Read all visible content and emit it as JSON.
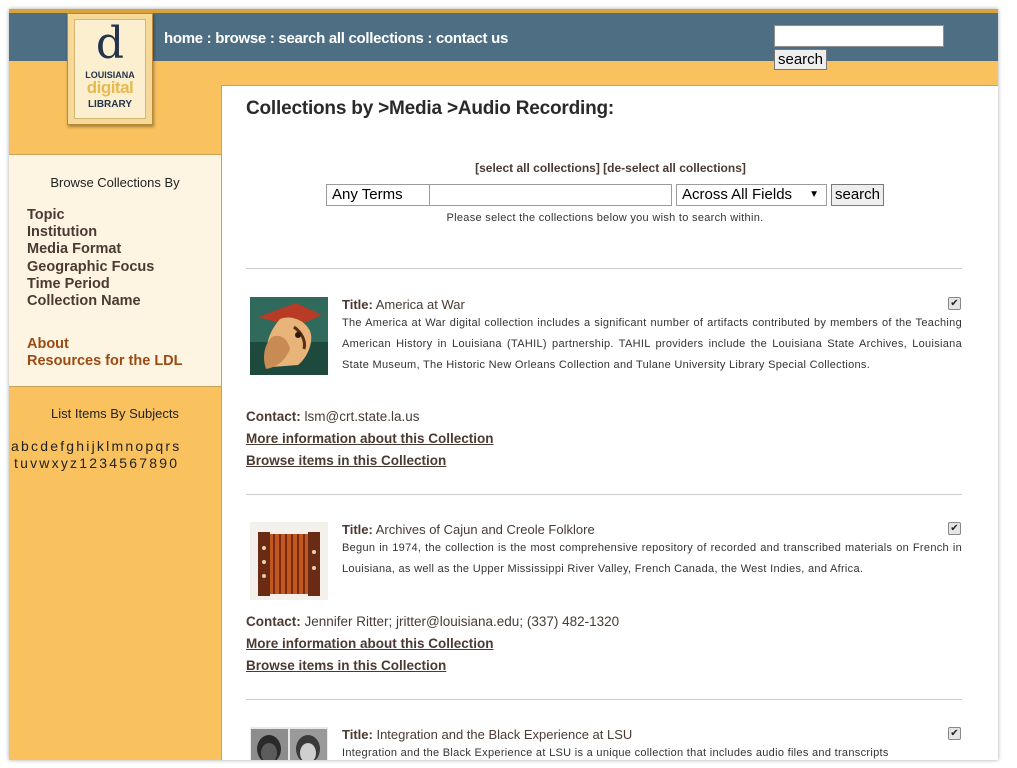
{
  "header": {
    "nav": [
      "home",
      "browse",
      "search all collections",
      "contact us"
    ],
    "separator": " : ",
    "search_button": "search"
  },
  "logo": {
    "line1": "LOUISIANA",
    "line2": "digital",
    "line3": "LIBRARY",
    "glyph": "d"
  },
  "sidebar": {
    "browse_heading": "Browse Collections By",
    "browse_links": [
      "Topic",
      "Institution",
      "Media Format",
      "Geographic Focus",
      "Time Period",
      "Collection Name"
    ],
    "about_links": [
      "About",
      "Resources for the LDL"
    ],
    "list_heading": "List Items By Subjects",
    "alphabet_row1": [
      "a",
      "b",
      "c",
      "d",
      "e",
      "f",
      "g",
      "h",
      "i",
      "j",
      "k",
      "l",
      "m",
      "n",
      "o",
      "p",
      "q",
      "r",
      "s"
    ],
    "alphabet_row2": [
      "t",
      "u",
      "v",
      "w",
      "x",
      "y",
      "z",
      "1",
      "2",
      "3",
      "4",
      "5",
      "6",
      "7",
      "8",
      "9",
      "0"
    ]
  },
  "main": {
    "page_title": "Collections by >Media >Audio Recording:",
    "select_all": "[select all collections]",
    "deselect_all": "[de-select all collections]",
    "term_select": "Any Terms",
    "field_select": "Across All Fields",
    "search_value": "",
    "search_button": "search",
    "hint": "Please select the collections below you wish to search within.",
    "title_label": "Title:",
    "contact_label": "Contact:",
    "more_info": "More information about this Collection",
    "browse_items": "Browse items in this Collection",
    "collections": [
      {
        "title": "America at War",
        "description": "The America at War digital collection includes a significant number of artifacts contributed by members of the Teaching American History in Louisiana (TAHIL) partnership. TAHIL providers include the Louisiana State Archives, Louisiana State Museum, The Historic New Orleans Collection and Tulane University Library Special Collections.",
        "contact": "lsm@crt.state.la.us",
        "checked": true
      },
      {
        "title": "Archives of Cajun and Creole Folklore",
        "description": "Begun in 1974, the collection is the most comprehensive repository of recorded and transcribed materials on French in Louisiana, as well as the Upper Mississippi River Valley, French Canada, the West Indies, and Africa.",
        "contact": "Jennifer Ritter; jritter@louisiana.edu; (337) 482-1320",
        "checked": true
      },
      {
        "title": "Integration and the Black Experience at LSU",
        "description": "Integration and the Black Experience at LSU is a unique collection that includes audio files and transcripts",
        "checked": true
      }
    ]
  },
  "colors": {
    "header_bar": "#4e6e84",
    "background": "#f9c25f",
    "sidebar_panel": "#fdf5e1",
    "link_brown": "#4a3a32",
    "link_orange": "#9b4a14"
  }
}
